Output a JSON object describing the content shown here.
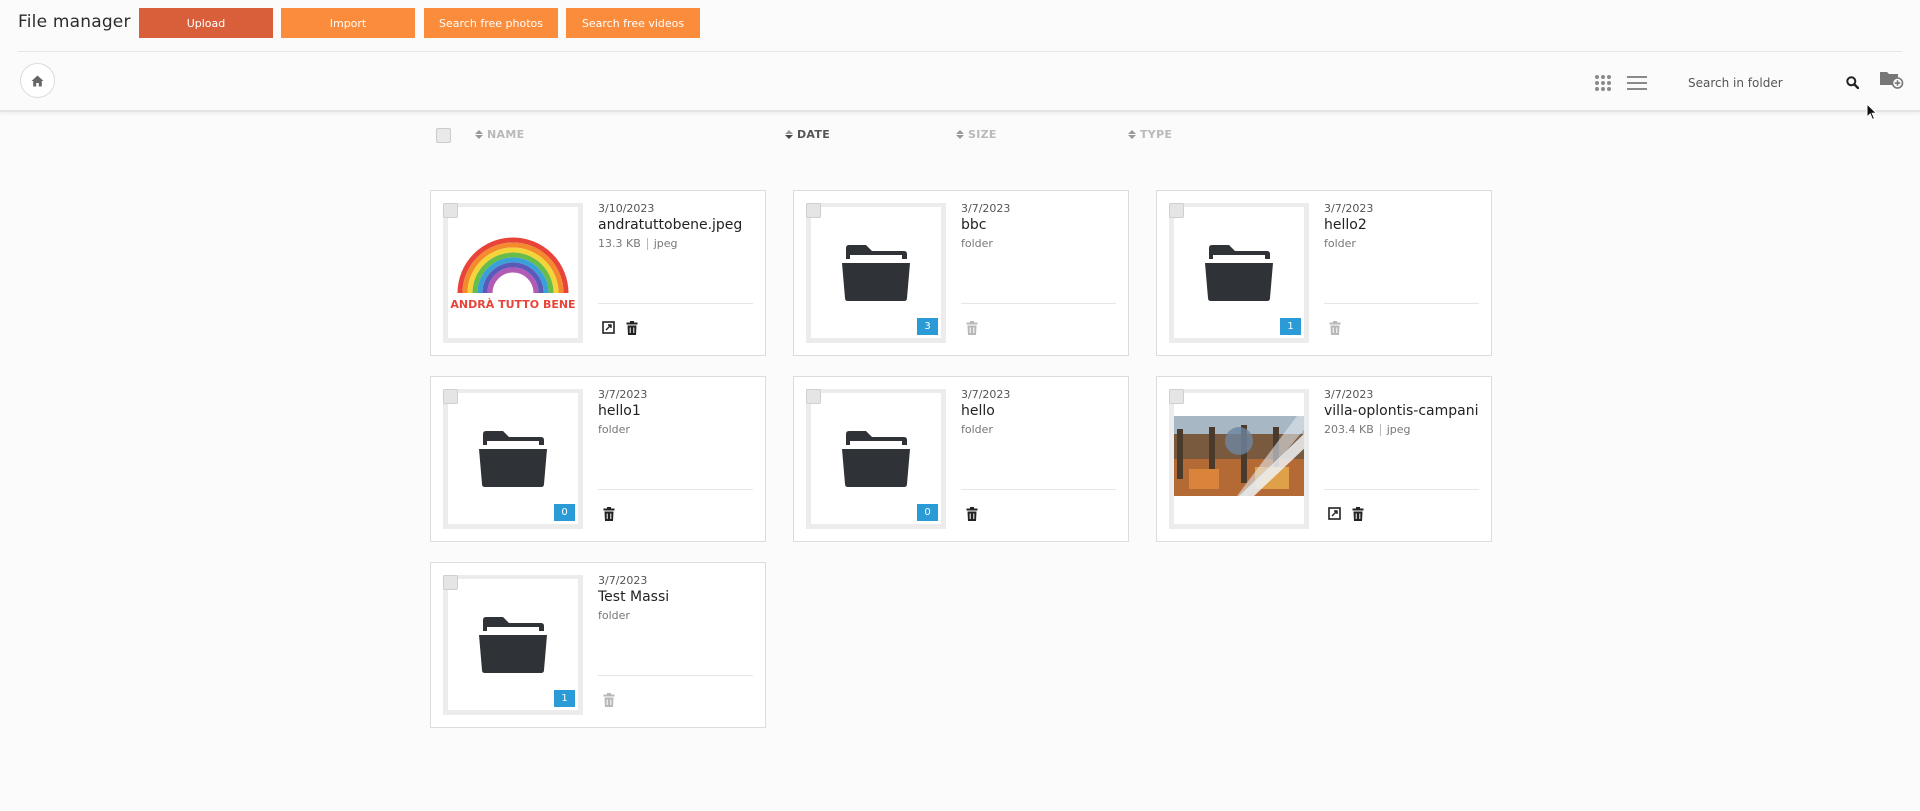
{
  "header": {
    "title": "File manager",
    "buttons": {
      "upload": "Upload",
      "import": "Import",
      "search_photos": "Search free photos",
      "search_videos": "Search free videos"
    }
  },
  "toolbar": {
    "search_placeholder": "Search in folder"
  },
  "columns": {
    "name": "NAME",
    "date": "DATE",
    "size": "SIZE",
    "type": "TYPE"
  },
  "items": [
    {
      "date": "3/10/2023",
      "name": "andratuttobene.jpeg",
      "size": "13.3 KB",
      "type": "jpeg",
      "kind": "image",
      "thumbnail_text": "ANDRÀ TUTTO BENE"
    },
    {
      "date": "3/7/2023",
      "name": "bbc",
      "type": "folder",
      "kind": "folder",
      "count": "3"
    },
    {
      "date": "3/7/2023",
      "name": "hello2",
      "type": "folder",
      "kind": "folder",
      "count": "1"
    },
    {
      "date": "3/7/2023",
      "name": "hello1",
      "type": "folder",
      "kind": "folder",
      "count": "0"
    },
    {
      "date": "3/7/2023",
      "name": "hello",
      "type": "folder",
      "kind": "folder",
      "count": "0"
    },
    {
      "date": "3/7/2023",
      "name": "villa-oplontis-campani",
      "size": "203.4 KB",
      "type": "jpeg",
      "kind": "image"
    },
    {
      "date": "3/7/2023",
      "name": "Test Massi",
      "type": "folder",
      "kind": "folder",
      "count": "1"
    }
  ],
  "colors": {
    "upload_button": "#d95f3b",
    "secondary_buttons": "#fb8c3c",
    "badge": "#2a9bd6",
    "folder_icon": "#2f3236"
  }
}
